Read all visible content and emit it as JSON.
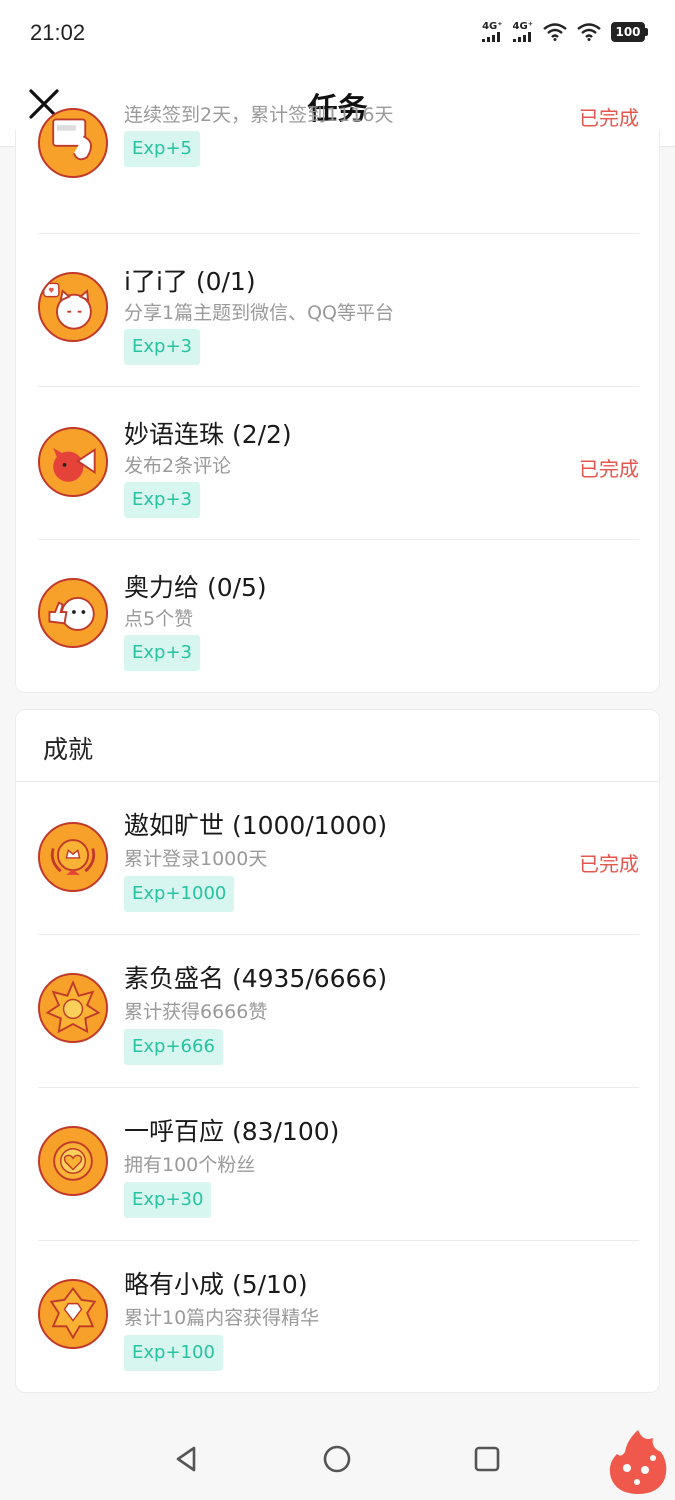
{
  "status": {
    "time": "21:02",
    "network1": "4G⁺",
    "network2": "4G⁺",
    "battery": "100"
  },
  "header": {
    "title": "任务"
  },
  "daily_tasks": [
    {
      "title": "",
      "desc": "连续签到2天，累计签到1116天",
      "exp": "Exp+5",
      "status": "已完成",
      "icon": "calendar-sign-icon"
    },
    {
      "title": "i了i了 (0/1)",
      "desc": "分享1篇主题到微信、QQ等平台",
      "exp": "Exp+3",
      "status": "",
      "icon": "cat-share-icon"
    },
    {
      "title": "妙语连珠 (2/2)",
      "desc": "发布2条评论",
      "exp": "Exp+3",
      "status": "已完成",
      "icon": "megaphone-icon"
    },
    {
      "title": "奥力给 (0/5)",
      "desc": "点5个赞",
      "exp": "Exp+3",
      "status": "",
      "icon": "cat-thumbs-up-icon"
    }
  ],
  "achievements": {
    "title": "成就",
    "items": [
      {
        "title": "遨如旷世 (1000/1000)",
        "desc": "累计登录1000天",
        "exp": "Exp+1000",
        "status": "已完成",
        "icon": "laurel-medal-icon"
      },
      {
        "title": "素负盛名 (4935/6666)",
        "desc": "累计获得6666赞",
        "exp": "Exp+666",
        "status": "",
        "icon": "star-medal-icon"
      },
      {
        "title": "一呼百应 (83/100)",
        "desc": "拥有100个粉丝",
        "exp": "Exp+30",
        "status": "",
        "icon": "heart-medal-icon"
      },
      {
        "title": "略有小成 (5/10)",
        "desc": "累计10篇内容获得精华",
        "exp": "Exp+100",
        "status": "",
        "icon": "diamond-medal-icon"
      }
    ]
  },
  "colors": {
    "accent_done": "#e5564d",
    "exp_text": "#27c3a1",
    "exp_bg": "#d6f6ef",
    "icon_fill": "#f8a12a",
    "icon_border": "#c0392b"
  }
}
